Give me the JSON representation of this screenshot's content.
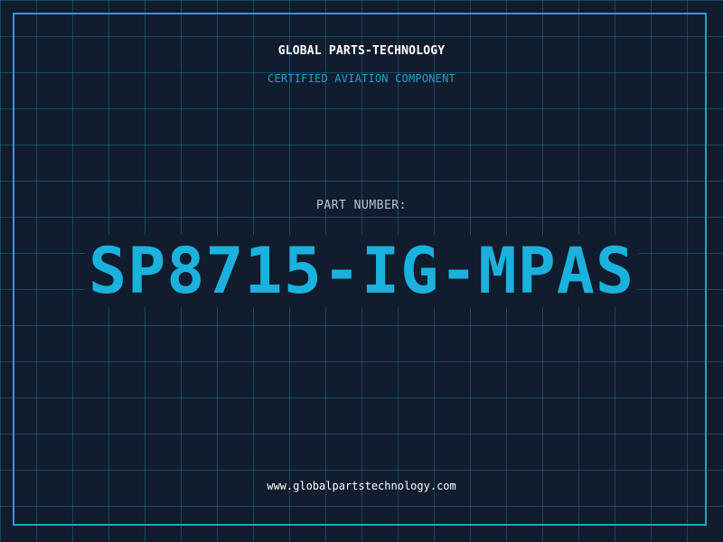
{
  "header": {
    "company": "GLOBAL PARTS-TECHNOLOGY",
    "tagline": "CERTIFIED AVIATION COMPONENT"
  },
  "part": {
    "label": "PART NUMBER:",
    "number": "SP8715-IG-MPAS"
  },
  "footer": {
    "website": "www.globalpartstechnology.com"
  },
  "colors": {
    "background": "#111c2e",
    "grid": "#1e6e8c",
    "accent": "#1ab2dc",
    "frame": "#1aa6cf"
  }
}
